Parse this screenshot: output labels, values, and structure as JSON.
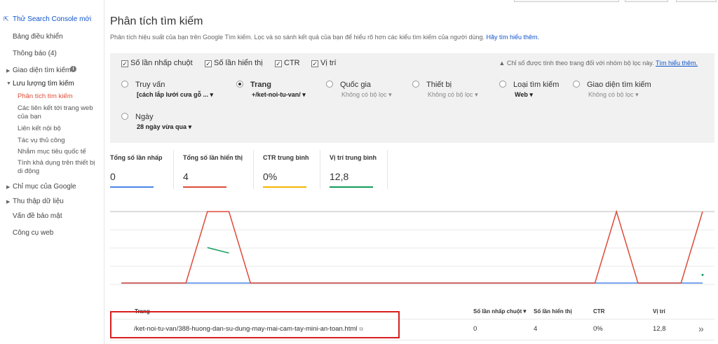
{
  "sidebar": {
    "new_console": "Thử Search Console mới",
    "dashboard": "Bảng điều khiển",
    "messages": "Thông báo (4)",
    "search_appearance": "Giao diện tìm kiếm",
    "search_traffic": "Lưu lượng tìm kiếm",
    "search_traffic_items": [
      "Phân tích tìm kiếm",
      "Các liên kết tới trang web của bạn",
      "Liên kết nội bộ",
      "Tác vụ thủ công",
      "Nhắm mục tiêu quốc tế",
      "Tính khả dụng trên thiết bị di động"
    ],
    "google_index": "Chỉ mục của Google",
    "crawl": "Thu thập dữ liệu",
    "security": "Vấn đề bảo mật",
    "web_tools": "Công cụ web"
  },
  "header": {
    "title": "Phân tích tìm kiếm",
    "description": "Phân tích hiệu suất của bạn trên Google Tìm kiếm. Lọc và so sánh kết quả của bạn để hiểu rõ hơn các kiểu tìm kiếm của người dùng.",
    "learn_more": "Hãy tìm hiểu thêm."
  },
  "filters": {
    "checkboxes": [
      "Số lần nhấp chuột",
      "Số lần hiển thị",
      "CTR",
      "Vị trí"
    ],
    "note": "Chỉ số được tính theo trang đối với nhóm bộ lọc này.",
    "note_link": "Tìm hiểu thêm.",
    "dimensions": [
      {
        "label": "Truy vấn",
        "sub": "[cách lắp lưới cưa gỗ ..."
      },
      {
        "label": "Trang",
        "sub": "+/ket-noi-tu-van/"
      },
      {
        "label": "Quốc gia",
        "sub": "Không có bộ lọc"
      },
      {
        "label": "Thiết bị",
        "sub": "Không có bộ lọc"
      },
      {
        "label": "Loại tìm kiếm",
        "sub": "Web"
      },
      {
        "label": "Giao diện tìm kiếm",
        "sub": "Không có bộ lọc"
      },
      {
        "label": "Ngày",
        "sub": "28 ngày vừa qua"
      }
    ]
  },
  "metrics": [
    {
      "label": "Tổng số lần nhấp",
      "value": "0",
      "color": "#4a86e8"
    },
    {
      "label": "Tổng số lần hiển thị",
      "value": "4",
      "color": "#dd4b39"
    },
    {
      "label": "CTR trung bình",
      "value": "0%",
      "color": "#f4b400"
    },
    {
      "label": "Vị trí trung bình",
      "value": "12,8",
      "color": "#0f9d58"
    }
  ],
  "chart_data": {
    "type": "line",
    "x": [
      1,
      2,
      3,
      4,
      5,
      6,
      7,
      8,
      9,
      10,
      11,
      12,
      13,
      14,
      15,
      16,
      17,
      18,
      19,
      20,
      21,
      22,
      23,
      24,
      25,
      26,
      27,
      28
    ],
    "series": [
      {
        "values": [
          0,
          0,
          0,
          0,
          1,
          1,
          0,
          0,
          0,
          0,
          0,
          0,
          0,
          0,
          0,
          0,
          0,
          0,
          0,
          0,
          0,
          0,
          0,
          1,
          0,
          0,
          0,
          1
        ],
        "color": "#dd4b39"
      },
      {
        "values": [
          0,
          0,
          0,
          0,
          0,
          0,
          0,
          0,
          0,
          0,
          0,
          0,
          0,
          0,
          0,
          0,
          0,
          0,
          0,
          0,
          0,
          0,
          0,
          0,
          0,
          0,
          0,
          0
        ],
        "color": "#4a86e8"
      },
      {
        "values": [
          null,
          null,
          null,
          null,
          10.5,
          12,
          null,
          null,
          null,
          null,
          null,
          null,
          null,
          null,
          null,
          null,
          null,
          null,
          null,
          null,
          null,
          null,
          null,
          null,
          null,
          null,
          null,
          18
        ],
        "color": "#0f9d58"
      }
    ],
    "grid": true
  },
  "table": {
    "headers": [
      "Trang",
      "Số lần nhấp chuột▼",
      "Số lần hiển thị",
      "CTR",
      "Vị trí"
    ],
    "rows": [
      {
        "page": "/ket-noi-tu-van/388-huong-dan-su-dung-may-mai-cam-tay-mini-an-toan.html",
        "clicks": "0",
        "impressions": "4",
        "ctr": "0%",
        "position": "12,8"
      }
    ]
  }
}
